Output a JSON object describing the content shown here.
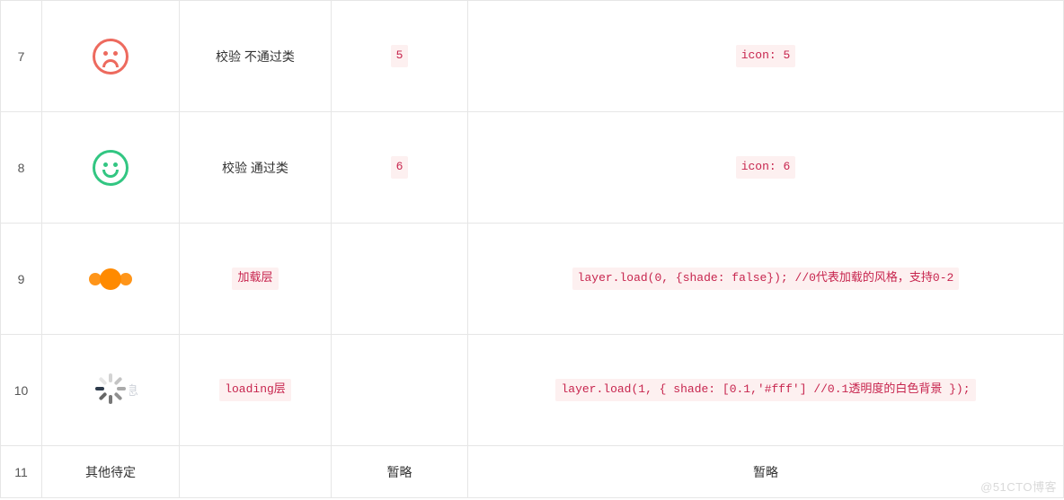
{
  "rows": [
    {
      "num": "7",
      "icon_kind": "face-sad",
      "name": "校验 不通过类",
      "value": "5",
      "code": "icon: 5"
    },
    {
      "num": "8",
      "icon_kind": "face-happy",
      "name": "校验 通过类",
      "value": "6",
      "code": "icon: 6"
    },
    {
      "num": "9",
      "icon_kind": "dots",
      "name": "加载层",
      "value": "",
      "code": "layer.load(0, {shade: false}); //0代表加载的风格，支持0-2"
    },
    {
      "num": "10",
      "icon_kind": "spinner",
      "name": "loading层",
      "value": "",
      "code": "layer.load(1, { shade: [0.1,'#fff'] //0.1透明度的白色背景 });"
    },
    {
      "num": "11",
      "icon_text": "其他待定",
      "name": "",
      "value": "暂略",
      "code_plain": "暂略"
    }
  ],
  "watermark": "@51CTO博客"
}
